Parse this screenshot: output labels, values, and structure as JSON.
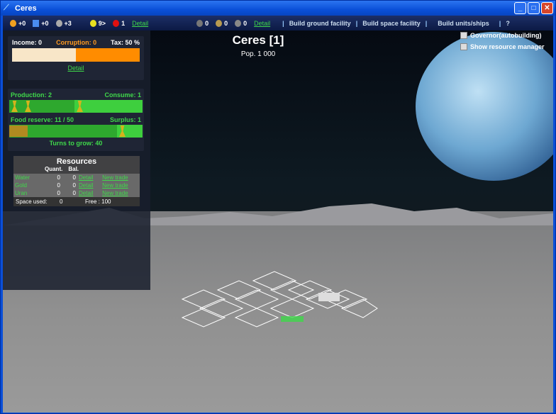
{
  "window": {
    "title": "Ceres"
  },
  "topbar": {
    "money": "+0",
    "science": "+0",
    "culture": "+3",
    "happiness": "9>",
    "unrest": "1",
    "detail1": "Detail",
    "military1": "0",
    "military2": "0",
    "military3": "0",
    "detail2": "Detail",
    "menu": [
      "Build ground facility",
      "Build space facility",
      "Build units/ships",
      "?"
    ]
  },
  "city": {
    "name": "Ceres [1]",
    "population": "Pop.  1 000"
  },
  "options": {
    "governor": "Governor(autobuilding)",
    "resource_manager": "Show resource manager"
  },
  "finance": {
    "income": "Income: 0",
    "corruption": "Corruption: 0",
    "tax": "Tax: 50 %",
    "tax_fraction": 0.5,
    "detail": "Detail",
    "colors": {
      "income": "#f8e6c8",
      "corruption": "#ff8c00"
    }
  },
  "food": {
    "production": "Production: 2",
    "consume": "Consume: 1",
    "reserve": "Food reserve: 11 / 50",
    "surplus": "Surplus: 1",
    "turns": "Turns to grow: 40",
    "reserve_fraction": 0.22
  },
  "resources": {
    "title": "Resources",
    "headers": [
      "Quant.",
      "Bal."
    ],
    "rows": [
      {
        "name": "Water",
        "quant": "0",
        "bal": "0",
        "detail": "Detail",
        "trade": "New trade"
      },
      {
        "name": "Gold",
        "quant": "0",
        "bal": "0",
        "detail": "Detail",
        "trade": "New trade"
      },
      {
        "name": "Uran",
        "quant": "0",
        "bal": "0",
        "detail": "Detail",
        "trade": "New trade"
      }
    ],
    "space_used_label": "Space used:",
    "space_used": "0",
    "free": "Free :  100"
  }
}
